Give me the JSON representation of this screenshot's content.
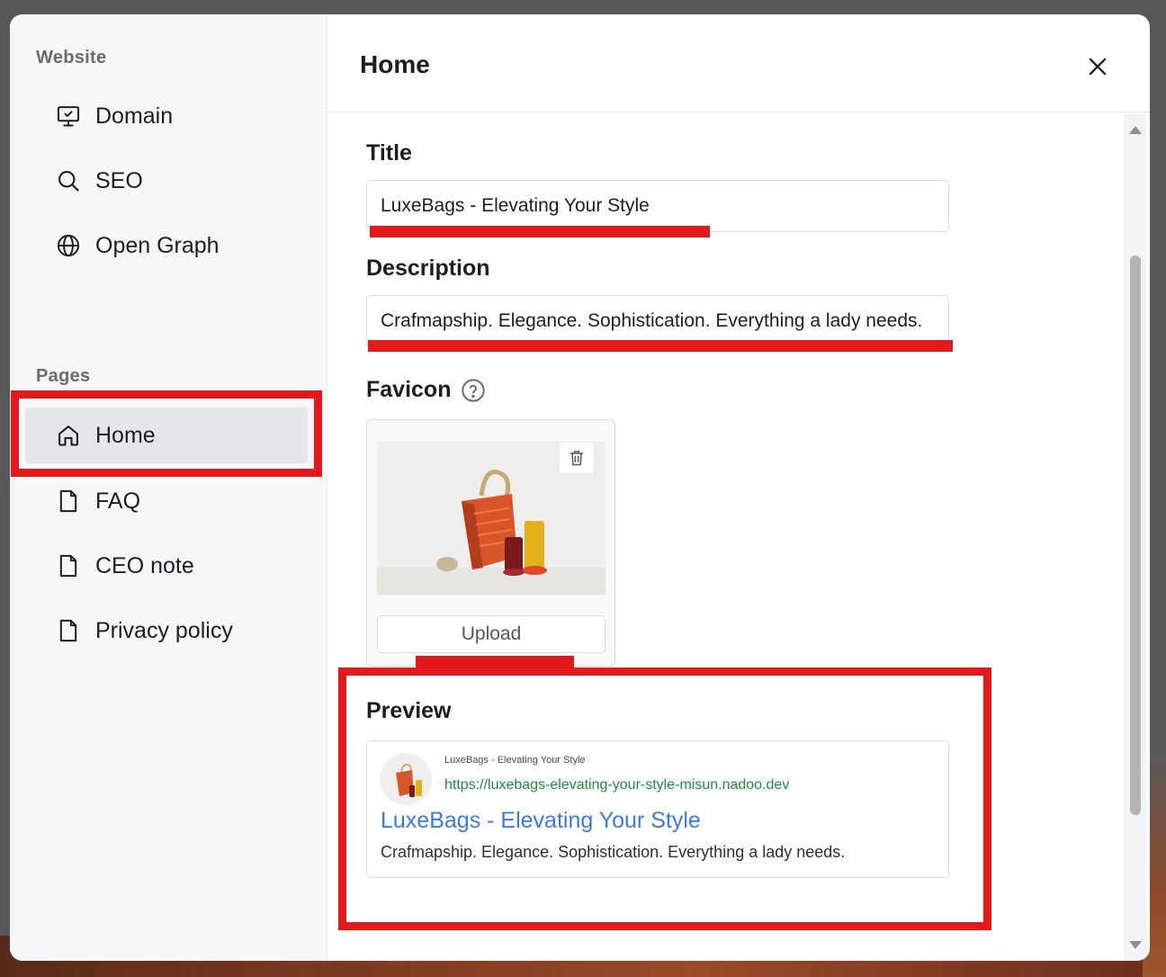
{
  "sidebar": {
    "website_section": "Website",
    "website_items": [
      {
        "label": "Domain",
        "icon": "monitor-check-icon"
      },
      {
        "label": "SEO",
        "icon": "search-icon"
      },
      {
        "label": "Open Graph",
        "icon": "globe-icon"
      }
    ],
    "pages_section": "Pages",
    "page_items": [
      {
        "label": "Home",
        "icon": "home-icon",
        "active": true
      },
      {
        "label": "FAQ",
        "icon": "file-icon"
      },
      {
        "label": "CEO note",
        "icon": "file-icon"
      },
      {
        "label": "Privacy policy",
        "icon": "file-icon"
      }
    ]
  },
  "header": {
    "title": "Home",
    "close_icon": "close-icon"
  },
  "form": {
    "title_label": "Title",
    "title_value": "LuxeBags - Elevating Your Style",
    "description_label": "Description",
    "description_value": "Crafmapship. Elegance. Sophistication. Everything a lady needs.",
    "favicon_label": "Favicon",
    "favicon_help_icon": "help-circle-icon",
    "delete_icon": "trash-icon",
    "upload_label": "Upload"
  },
  "preview": {
    "label": "Preview",
    "site_name": "LuxeBags - Elevating Your Style",
    "url": "https://luxebags-elevating-your-style-misun.nadoo.dev",
    "title": "LuxeBags - Elevating Your Style",
    "description": "Crafmapship. Elegance. Sophistication. Everything a lady needs."
  },
  "colors": {
    "annotation_red": "#e31a1c",
    "link_blue": "#3a7be0",
    "url_green": "#1e8a3c",
    "active_nav": "#e6e6ea"
  }
}
